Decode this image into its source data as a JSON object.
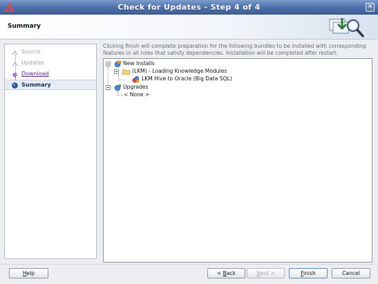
{
  "window": {
    "title": "Check for Updates - Step 4 of 4",
    "close_glyph": "✕"
  },
  "header": {
    "title": "Summary"
  },
  "steps": [
    {
      "label": "Source",
      "state": "done"
    },
    {
      "label": "Updates",
      "state": "done"
    },
    {
      "label": "Download",
      "state": "link"
    },
    {
      "label": "Summary",
      "state": "active"
    }
  ],
  "description": "Clicking finish will complete preparation for the following bundles to be installed with corresponding features in all roles that satisfy dependencies. Installation will be completed after restart.",
  "tree": {
    "new_installs": "New Installs",
    "lkm_folder": "(LKM) - Loading Knowledge Modules",
    "lkm_item": "LKM Hive to Oracle (Big Data SQL)",
    "upgrades": "Upgrades",
    "none": "< None >"
  },
  "buttons": {
    "help_pre": "",
    "help_mn": "H",
    "help_post": "elp",
    "back_pre": "< ",
    "back_mn": "B",
    "back_post": "ack",
    "next_pre": "",
    "next_mn": "N",
    "next_post": "ext >",
    "finish_pre": "",
    "finish_mn": "F",
    "finish_post": "inish",
    "cancel": "Cancel"
  },
  "icons": {
    "app": "oracle-triangle-icon",
    "header": "update-magnifier-icon",
    "installs": "globe-package-icon",
    "folder": "folder-icon",
    "item": "module-package-icon",
    "upgrades": "globe-upgrade-icon"
  },
  "colors": {
    "title_bar": "#4d6fa9",
    "active_step": "#102c59",
    "link": "#5a2a7c"
  }
}
